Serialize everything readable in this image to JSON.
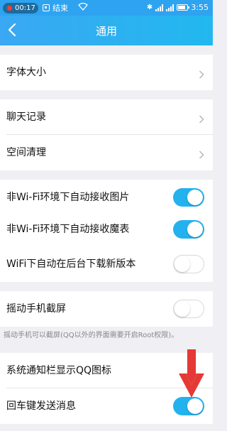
{
  "statusbar": {
    "rec_time": "00:17",
    "stop_label": "结束",
    "clock": "3:55"
  },
  "header": {
    "title": "通用"
  },
  "sections": {
    "font": {
      "font_size": "字体大小"
    },
    "storage": {
      "chat_history": "聊天记录",
      "space_cleanup": "空间清理"
    },
    "network": {
      "auto_receive_images": {
        "label": "非Wi-Fi环境下自动接收图片",
        "enabled": true
      },
      "auto_receive_magic_emoji": {
        "label": "非Wi-Fi环境下自动接收魔表",
        "enabled": true
      },
      "auto_download_update": {
        "label": "WiFi下自动在后台下载新版本",
        "enabled": false
      }
    },
    "screenshot": {
      "shake_screenshot": {
        "label": "摇动手机截屏",
        "enabled": false
      },
      "hint": "摇动手机可以截屏(QQ以外的界面需要开启Root权限)。"
    },
    "notify": {
      "show_qq_icon": {
        "label": "系统通知栏显示QQ图标"
      },
      "enter_to_send": {
        "label": "回车键发送消息",
        "enabled": true
      }
    }
  },
  "colors": {
    "accent": "#23b2ee",
    "header": "#2ea3f0",
    "annotation_arrow": "#e53935"
  }
}
